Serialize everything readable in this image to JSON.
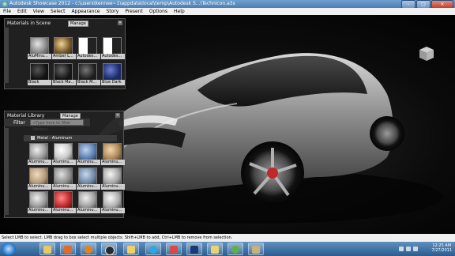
{
  "window": {
    "title": "Autodesk Showcase 2012 - c:\\users\\kennee~1\\appdata\\local\\temp\\Autodesk S...\\Technicon.a3s",
    "min": "–",
    "max": "□",
    "close": "✕"
  },
  "menu": [
    "File",
    "Edit",
    "View",
    "Select",
    "Appearance",
    "Story",
    "Present",
    "Options",
    "Help"
  ],
  "materials_in_scene": {
    "title": "Materials in Scene",
    "manage": "Manage",
    "items": [
      {
        "label": "AluMinu...",
        "swatch": "#8a8a8a"
      },
      {
        "label": "Amber L...",
        "swatch": "#7a5a2a"
      },
      {
        "label": "Autodes...",
        "swatch": "#e8e8e8"
      },
      {
        "label": "Autodes...",
        "swatch": "#e8e8e8"
      },
      {
        "label": "Black",
        "swatch": "#1a1a1a"
      },
      {
        "label": "Black Ma...",
        "swatch": "#202020"
      },
      {
        "label": "Black M...",
        "swatch": "#2a2a2a"
      },
      {
        "label": "Blue Dark",
        "swatch": "#1b2a66"
      }
    ]
  },
  "material_library": {
    "title": "Material Library",
    "manage": "Manage",
    "filter_label": "Filter",
    "filter_placeholder": "<Type here to filter library>",
    "group": "Metal - Aluminum",
    "items": [
      {
        "label": "Aluminu...",
        "swatch": "#9a9a9a"
      },
      {
        "label": "Aluminu...",
        "swatch": "#c9c9c9"
      },
      {
        "label": "Aluminu...",
        "swatch": "#5b7fb0"
      },
      {
        "label": "Aluminu...",
        "swatch": "#b28a5a"
      },
      {
        "label": "Aluminu...",
        "swatch": "#b69a7a"
      },
      {
        "label": "Aluminu...",
        "swatch": "#8f8f8f"
      },
      {
        "label": "Aluminu...",
        "swatch": "#6f8aa8"
      },
      {
        "label": "Aluminu...",
        "swatch": "#a8a8a8"
      },
      {
        "label": "Aluminu...",
        "swatch": "#9a9a9a"
      },
      {
        "label": "Aluminu...",
        "swatch": "#c0282a"
      },
      {
        "label": "Aluminu...",
        "swatch": "#a0a0a0"
      },
      {
        "label": "Aluminu...",
        "swatch": "#b0b0b0"
      }
    ]
  },
  "status": "Select LMB to select. LMB drag to box select multiple objects. Shift+LMB to add, Ctrl+LMB to remove from selection.",
  "clock": {
    "time": "12:25 AM",
    "date": "7/27/2011"
  },
  "taskbar": [
    {
      "name": "explorer-taskbar-icon",
      "color": "#e8c96a"
    },
    {
      "name": "media-player-taskbar-icon",
      "color": "#e06b2b"
    },
    {
      "name": "firefox-taskbar-icon",
      "color": "#e5821e"
    },
    {
      "name": "steam-taskbar-icon",
      "color": "#2a2a2a"
    },
    {
      "name": "folder-taskbar-icon",
      "color": "#f0d060"
    },
    {
      "name": "skype-taskbar-icon",
      "color": "#2aa8e0"
    },
    {
      "name": "paint-taskbar-icon",
      "color": "#d64a4a"
    },
    {
      "name": "photoshop-taskbar-icon",
      "color": "#1b3a73"
    },
    {
      "name": "explorer-window-taskbar-icon",
      "color": "#e8d470"
    },
    {
      "name": "messenger-taskbar-icon",
      "color": "#5fb04a"
    },
    {
      "name": "showcase-taskbar-icon",
      "color": "#c9b27a"
    }
  ]
}
